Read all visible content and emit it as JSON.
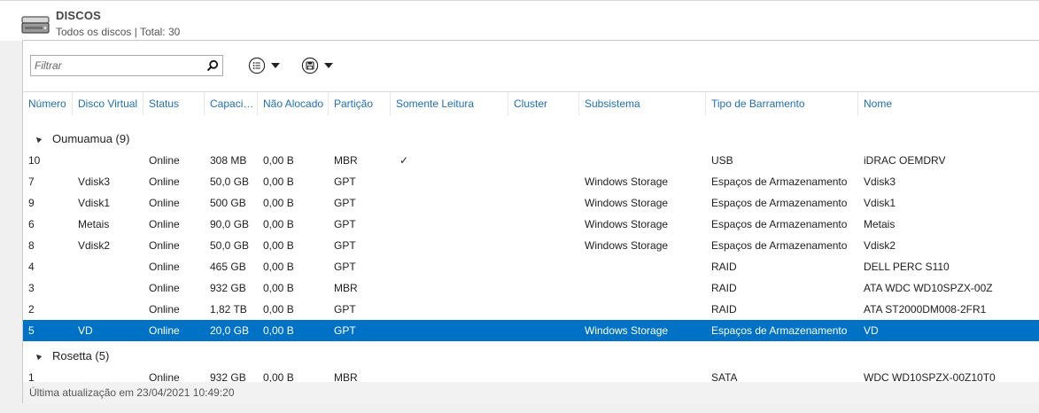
{
  "header": {
    "title": "DISCOS",
    "subtitle": "Todos os discos | Total: 30"
  },
  "toolbar": {
    "filter_placeholder": "Filtrar",
    "filter_value": ""
  },
  "columns": [
    "Número",
    "Disco Virtual",
    "Status",
    "Capacidade",
    "Não Alocado",
    "Partição",
    "Somente Leitura",
    "Cluster",
    "Subsistema",
    "Tipo de Barramento",
    "Nome"
  ],
  "groups": [
    {
      "label": "Oumuamua (9)",
      "rows": [
        {
          "num": "10",
          "vdisk": "",
          "status": "Online",
          "cap": "308 MB",
          "unalloc": "0,00 B",
          "part": "MBR",
          "ro": "✓",
          "cluster": "",
          "subsys": "",
          "bus": "USB",
          "name": "iDRAC OEMDRV",
          "selected": false
        },
        {
          "num": "7",
          "vdisk": "Vdisk3",
          "status": "Online",
          "cap": "50,0 GB",
          "unalloc": "0,00 B",
          "part": "GPT",
          "ro": "",
          "cluster": "",
          "subsys": "Windows Storage",
          "bus": "Espaços de Armazenamento",
          "name": "Vdisk3",
          "selected": false
        },
        {
          "num": "9",
          "vdisk": "Vdisk1",
          "status": "Online",
          "cap": "500 GB",
          "unalloc": "0,00 B",
          "part": "GPT",
          "ro": "",
          "cluster": "",
          "subsys": "Windows Storage",
          "bus": "Espaços de Armazenamento",
          "name": "Vdisk1",
          "selected": false
        },
        {
          "num": "6",
          "vdisk": "Metais",
          "status": "Online",
          "cap": "90,0 GB",
          "unalloc": "0,00 B",
          "part": "GPT",
          "ro": "",
          "cluster": "",
          "subsys": "Windows Storage",
          "bus": "Espaços de Armazenamento",
          "name": "Metais",
          "selected": false
        },
        {
          "num": "8",
          "vdisk": "Vdisk2",
          "status": "Online",
          "cap": "50,0 GB",
          "unalloc": "0,00 B",
          "part": "GPT",
          "ro": "",
          "cluster": "",
          "subsys": "Windows Storage",
          "bus": "Espaços de Armazenamento",
          "name": "Vdisk2",
          "selected": false
        },
        {
          "num": "4",
          "vdisk": "",
          "status": "Online",
          "cap": "465 GB",
          "unalloc": "0,00 B",
          "part": "GPT",
          "ro": "",
          "cluster": "",
          "subsys": "",
          "bus": "RAID",
          "name": "DELL PERC S110",
          "selected": false
        },
        {
          "num": "3",
          "vdisk": "",
          "status": "Online",
          "cap": "932 GB",
          "unalloc": "0,00 B",
          "part": "MBR",
          "ro": "",
          "cluster": "",
          "subsys": "",
          "bus": "RAID",
          "name": "ATA WDC WD10SPZX-00Z",
          "selected": false
        },
        {
          "num": "2",
          "vdisk": "",
          "status": "Online",
          "cap": "1,82 TB",
          "unalloc": "0,00 B",
          "part": "GPT",
          "ro": "",
          "cluster": "",
          "subsys": "",
          "bus": "RAID",
          "name": "ATA ST2000DM008-2FR1",
          "selected": false
        },
        {
          "num": "5",
          "vdisk": "VD",
          "status": "Online",
          "cap": "20,0 GB",
          "unalloc": "0,00 B",
          "part": "GPT",
          "ro": "",
          "cluster": "",
          "subsys": "Windows Storage",
          "bus": "Espaços de Armazenamento",
          "name": "VD",
          "selected": true
        }
      ]
    },
    {
      "label": "Rosetta (5)",
      "rows": [
        {
          "num": "1",
          "vdisk": "",
          "status": "Online",
          "cap": "932 GB",
          "unalloc": "0,00 B",
          "part": "MBR",
          "ro": "",
          "cluster": "",
          "subsys": "",
          "bus": "SATA",
          "name": "WDC WD10SPZX-00Z10T0",
          "selected": false
        }
      ]
    }
  ],
  "status_bar": "Última atualização em 23/04/2021 10:49:20",
  "colors": {
    "accent": "#0072c6",
    "header_text": "#1e6fb8"
  },
  "icons": {
    "disk": "disk-drive-icon",
    "search": "search-icon",
    "list": "list-icon",
    "save": "save-icon",
    "dropdown": "chevron-down-icon",
    "expand": "collapse-triangle-icon"
  }
}
